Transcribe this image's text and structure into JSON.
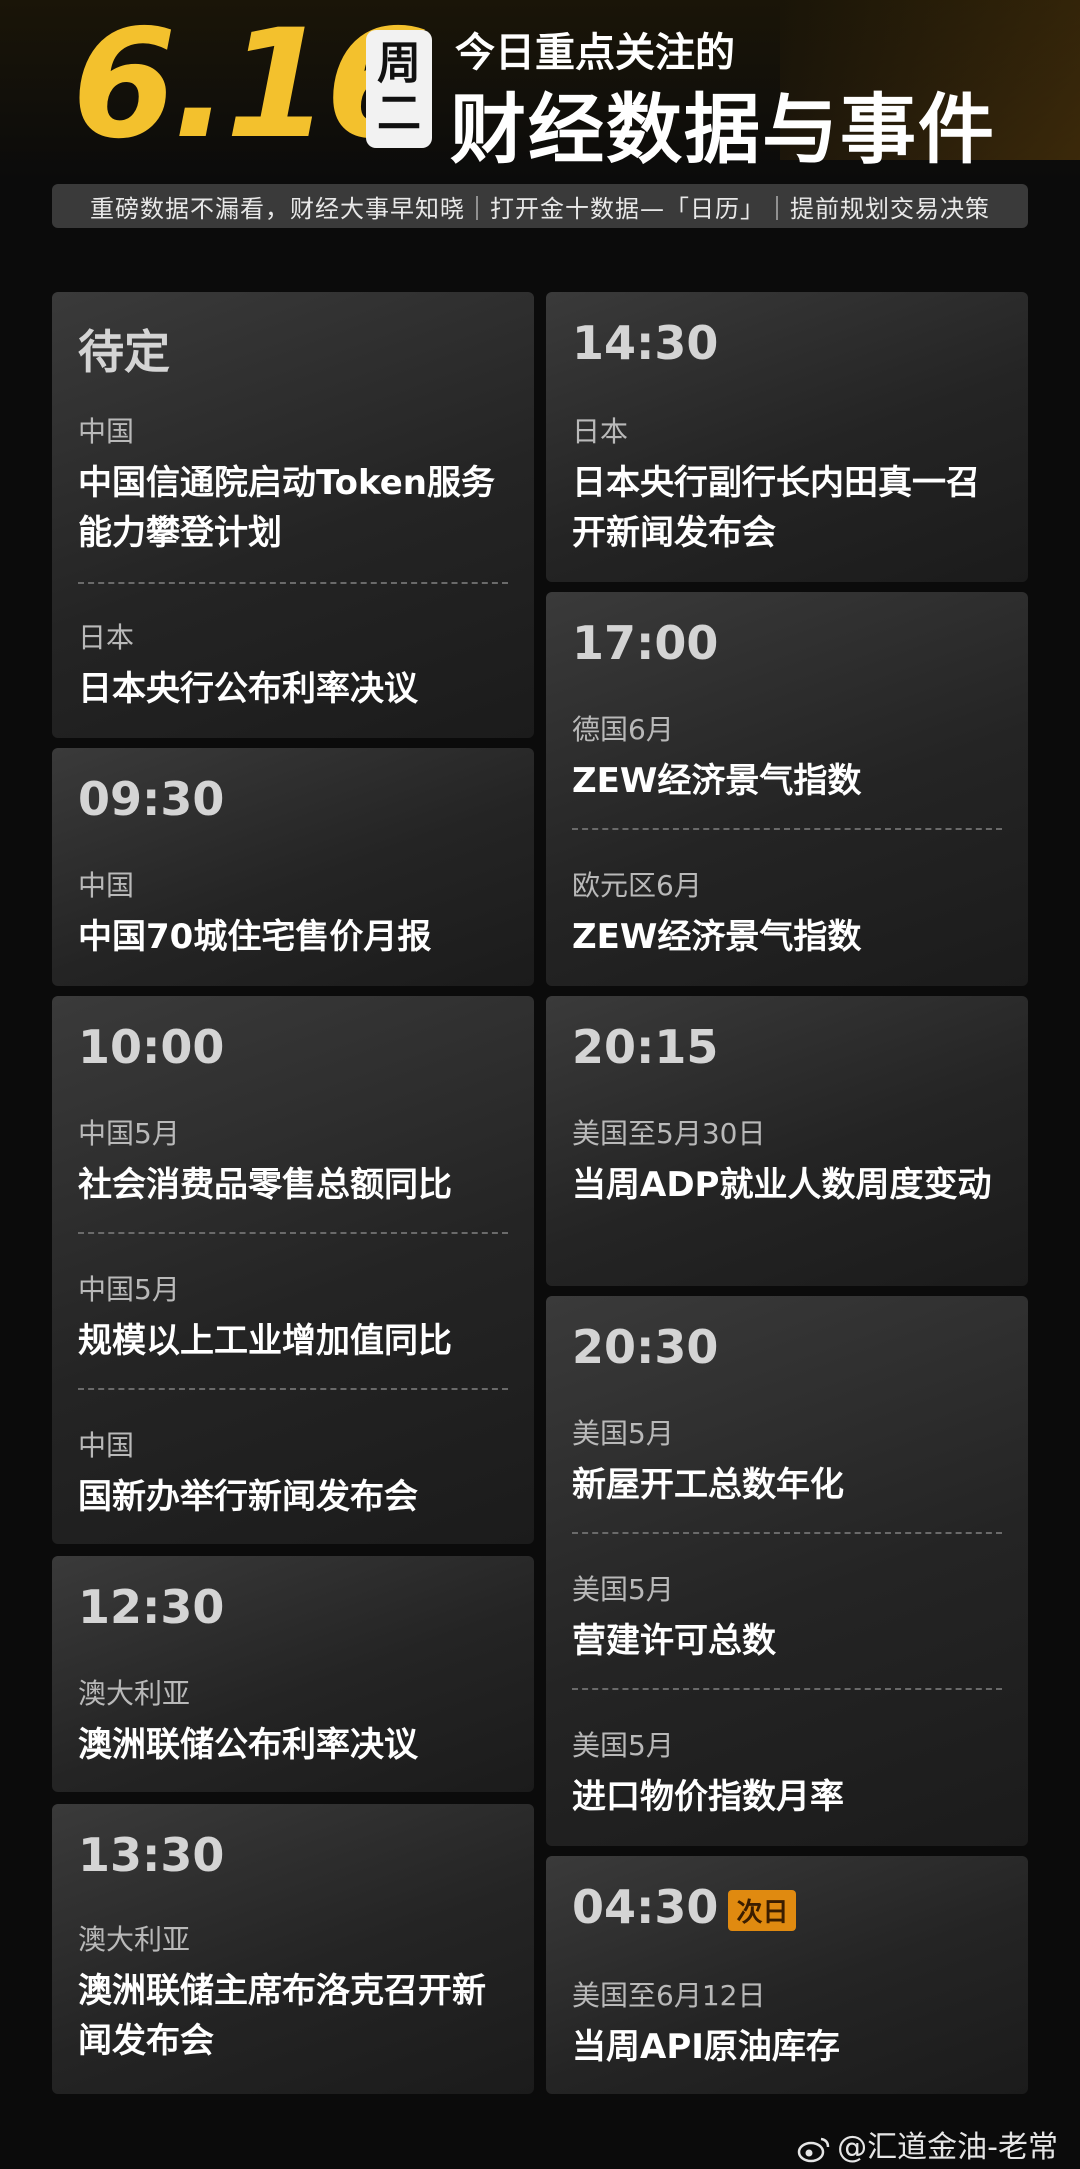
{
  "header": {
    "date": "6.16",
    "weekday_1": "周",
    "weekday_2": "二",
    "title_small": "今日重点关注的",
    "title_big": "财经数据与事件",
    "subtitle": "重磅数据不漏看，财经大事早知晓｜打开金十数据—「日历」｜提前规划交易决策"
  },
  "left": [
    {
      "time": "待定",
      "events": [
        {
          "region": "中国",
          "name": "中国信通院启动Token服务能力攀登计划"
        },
        {
          "region": "日本",
          "name": "日本央行公布利率决议"
        }
      ]
    },
    {
      "time": "09:30",
      "events": [
        {
          "region": "中国",
          "name": "中国70城住宅售价月报"
        }
      ]
    },
    {
      "time": "10:00",
      "events": [
        {
          "region": "中国5月",
          "name": "社会消费品零售总额同比"
        },
        {
          "region": "中国5月",
          "name": "规模以上工业增加值同比"
        },
        {
          "region": "中国",
          "name": "国新办举行新闻发布会"
        }
      ]
    },
    {
      "time": "12:30",
      "events": [
        {
          "region": "澳大利亚",
          "name": "澳洲联储公布利率决议"
        }
      ]
    },
    {
      "time": "13:30",
      "events": [
        {
          "region": "澳大利亚",
          "name": "澳洲联储主席布洛克召开新闻发布会"
        }
      ]
    }
  ],
  "right": [
    {
      "time": "14:30",
      "events": [
        {
          "region": "日本",
          "name": "日本央行副行长内田真一召开新闻发布会"
        }
      ]
    },
    {
      "time": "17:00",
      "events": [
        {
          "region": "德国6月",
          "name": "ZEW经济景气指数"
        },
        {
          "region": "欧元区6月",
          "name": "ZEW经济景气指数"
        }
      ]
    },
    {
      "time": "20:15",
      "events": [
        {
          "region": "美国至5月30日",
          "name": "当周ADP就业人数周度变动"
        }
      ]
    },
    {
      "time": "20:30",
      "events": [
        {
          "region": "美国5月",
          "name": "新屋开工总数年化"
        },
        {
          "region": "美国5月",
          "name": "营建许可总数"
        },
        {
          "region": "美国5月",
          "name": "进口物价指数月率"
        }
      ]
    },
    {
      "time": "04:30",
      "badge": "次日",
      "events": [
        {
          "region": "美国至6月12日",
          "name": "当周API原油库存"
        }
      ]
    }
  ],
  "watermark": "@汇道金油-老常",
  "colors": {
    "accent_gold": "#f3c12d",
    "badge_orange": "#e08a10"
  }
}
